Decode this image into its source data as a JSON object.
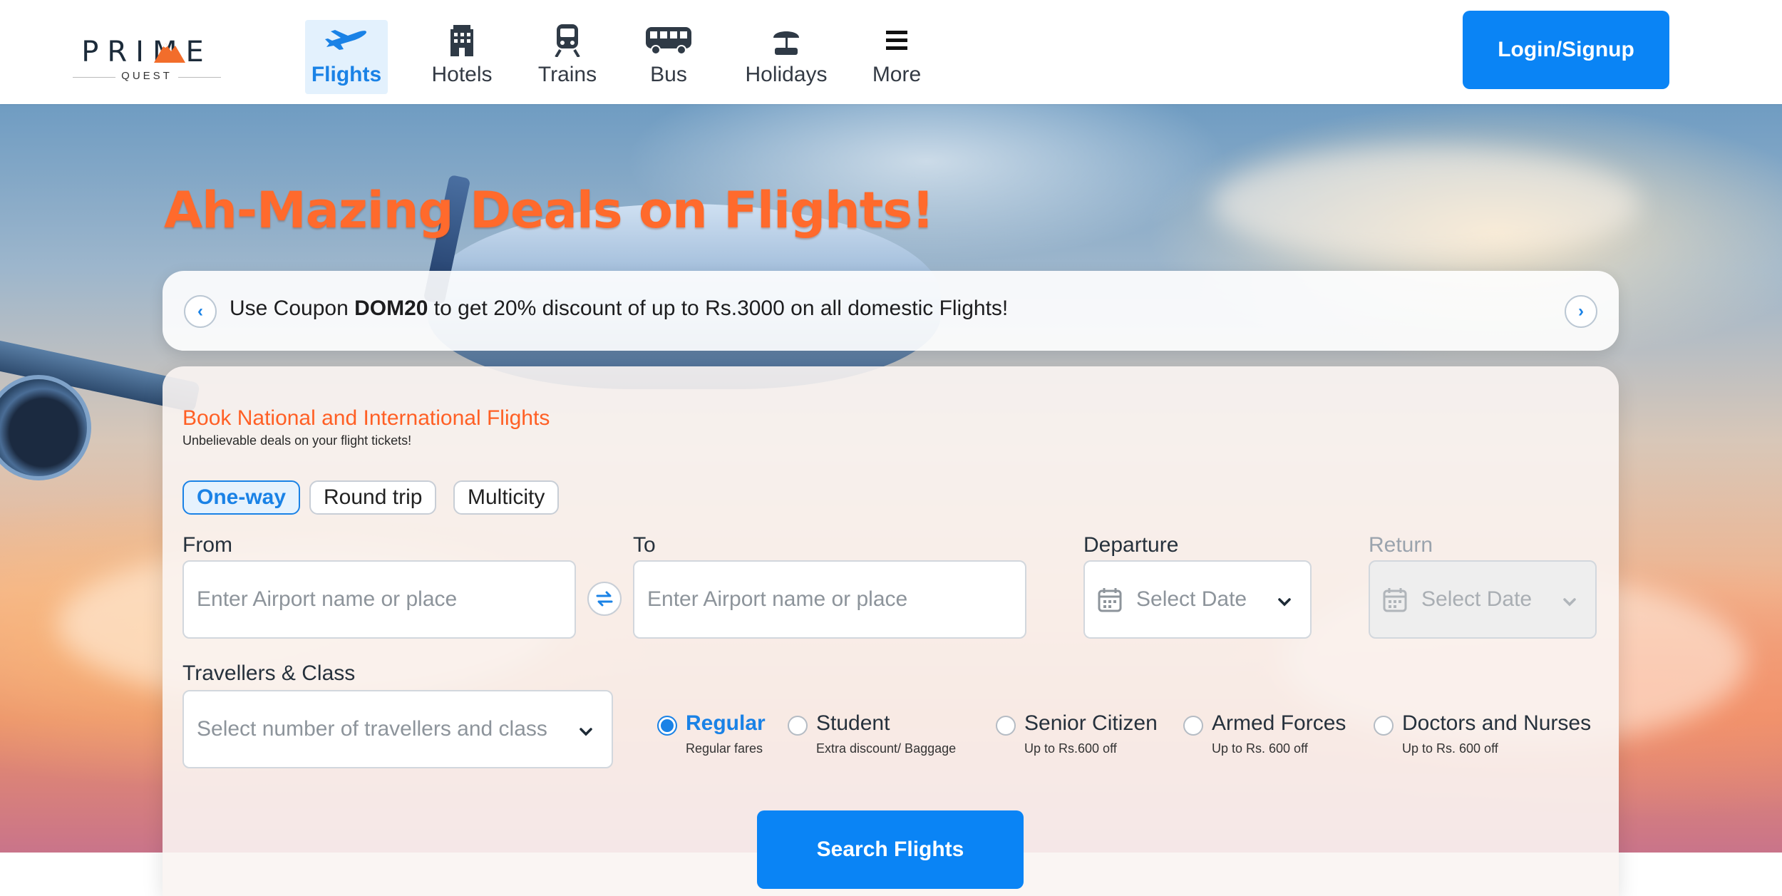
{
  "brand": {
    "name": "PRIME",
    "tagline": "QUEST"
  },
  "nav": {
    "items": [
      {
        "label": "Flights",
        "icon": "airplane-icon",
        "active": true
      },
      {
        "label": "Hotels",
        "icon": "hotel-icon",
        "active": false
      },
      {
        "label": "Trains",
        "icon": "train-icon",
        "active": false
      },
      {
        "label": "Bus",
        "icon": "bus-icon",
        "active": false
      },
      {
        "label": "Holidays",
        "icon": "beach-umbrella-icon",
        "active": false
      },
      {
        "label": "More",
        "icon": "menu-icon",
        "active": false
      }
    ],
    "login_label": "Login/Signup"
  },
  "hero": {
    "title": "Ah-Mazing Deals on Flights!"
  },
  "coupon": {
    "prefix": "Use Coupon ",
    "code": "DOM20",
    "suffix": " to get 20% discount of up to Rs.3000 on all domestic Flights!"
  },
  "booking": {
    "title": "Book National and International Flights",
    "subtitle": "Unbelievable deals on your flight tickets!",
    "trip_types": [
      "One-way",
      "Round trip",
      "Multicity"
    ],
    "active_trip_type": "One-way",
    "from": {
      "label": "From",
      "placeholder": "Enter Airport name or place"
    },
    "to": {
      "label": "To",
      "placeholder": "Enter Airport name or place"
    },
    "departure": {
      "label": "Departure",
      "placeholder": "Select Date"
    },
    "return": {
      "label": "Return",
      "placeholder": "Select Date",
      "disabled": true
    },
    "travellers": {
      "label": "Travellers & Class",
      "placeholder": "Select number of travellers and class"
    },
    "fares": [
      {
        "name": "Regular",
        "sub": "Regular fares",
        "selected": true
      },
      {
        "name": "Student",
        "sub": "Extra discount/ Baggage",
        "selected": false
      },
      {
        "name": "Senior Citizen",
        "sub": "Up to Rs.600 off",
        "selected": false
      },
      {
        "name": "Armed Forces",
        "sub": "Up to Rs. 600 off",
        "selected": false
      },
      {
        "name": "Doctors and Nurses",
        "sub": "Up to Rs. 600 off",
        "selected": false
      }
    ],
    "search_label": "Search Flights"
  },
  "colors": {
    "primary": "#0a84f5",
    "accent_orange": "#ff6a2c",
    "active_tab_bg": "#e3f1fd"
  }
}
